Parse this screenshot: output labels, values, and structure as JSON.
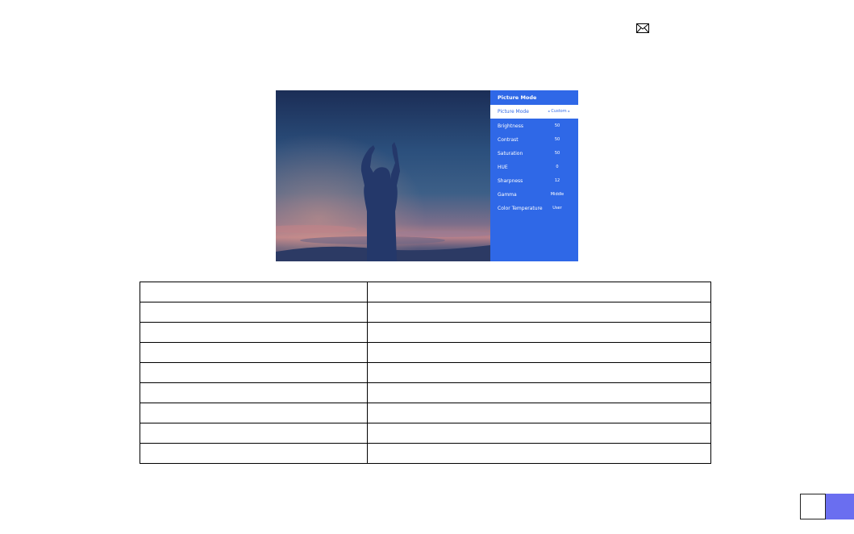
{
  "osd": {
    "title": "Picture Mode",
    "selected": {
      "label": "Picture Mode",
      "value": "Custom",
      "left_arrow": "◂",
      "right_arrow": "▸"
    },
    "items": [
      {
        "label": "Brightness",
        "value": "50"
      },
      {
        "label": "Contrast",
        "value": "50"
      },
      {
        "label": "Saturation",
        "value": "50"
      },
      {
        "label": "HUE",
        "value": "0"
      },
      {
        "label": "Sharpness",
        "value": "12"
      },
      {
        "label": "Gamma",
        "value": "Middle"
      },
      {
        "label": "Color Temperature",
        "value": "User"
      }
    ]
  },
  "table": {
    "rows": [
      [
        "",
        ""
      ],
      [
        "",
        ""
      ],
      [
        "",
        ""
      ],
      [
        "",
        ""
      ],
      [
        "",
        ""
      ],
      [
        "",
        ""
      ],
      [
        "",
        ""
      ],
      [
        "",
        ""
      ],
      [
        "",
        ""
      ]
    ]
  },
  "colors": {
    "osd_blue": "#2f68e7",
    "page_accent": "#6a6ef0"
  },
  "icons": {
    "mail": "envelope-icon"
  }
}
